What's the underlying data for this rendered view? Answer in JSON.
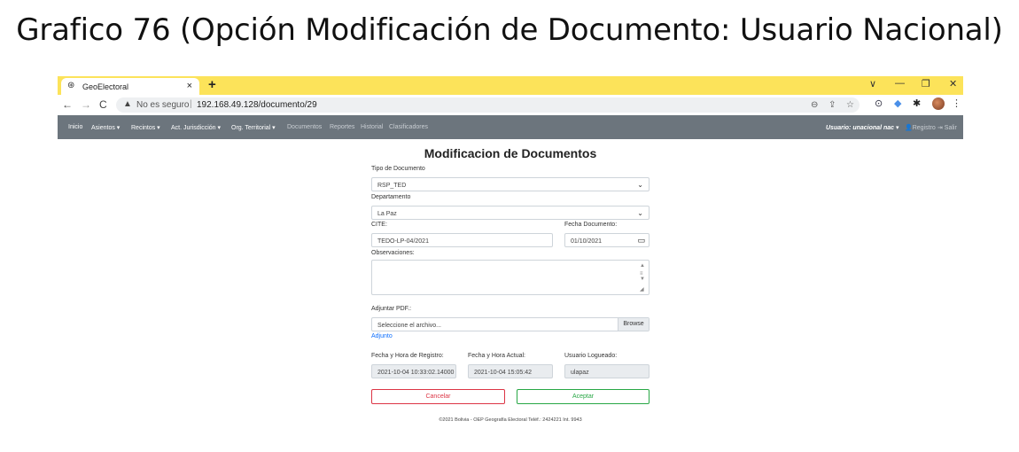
{
  "slide_title": "Grafico 76 (Opción Modificación de Documento: Usuario Nacional)",
  "browser": {
    "tab_title": "GeoElectoral",
    "tab_close": "×",
    "new_tab": "+",
    "insecure_label": "No es seguro",
    "separator": "|",
    "url": "192.168.49.128/documento/29"
  },
  "navbar": {
    "items": [
      {
        "label": "Inicio"
      },
      {
        "label": "Asientos ▾"
      },
      {
        "label": "Recintos ▾"
      },
      {
        "label": "Act. Jurisdicción ▾"
      },
      {
        "label": "Org. Territorial ▾"
      },
      {
        "label": "Documentos"
      },
      {
        "label": "Reportes"
      },
      {
        "label": "Historial"
      },
      {
        "label": "Clasificadores"
      }
    ],
    "user": "Usuario: unacional nac ▾",
    "registro": "👤Registro",
    "salir": "⇥ Salir"
  },
  "form": {
    "heading": "Modificacion de Documentos",
    "tipo_documento": {
      "label": "Tipo de Documento",
      "value": "RSP_TED"
    },
    "departamento": {
      "label": "Departamento",
      "value": "La Paz"
    },
    "cite": {
      "label": "CITE:",
      "value": "TEDO-LP-04/2021"
    },
    "fecha_documento": {
      "label": "Fecha Documento:",
      "value": "01/10/2021"
    },
    "observaciones": {
      "label": "Observaciones:",
      "value": ""
    },
    "adjuntar": {
      "label": "Adjuntar PDF.:",
      "placeholder": "Seleccione el archivo...",
      "browse": "Browse"
    },
    "adjunto_link": "Adjunto",
    "fecha_registro": {
      "label": "Fecha y Hora de Registro:",
      "value": "2021-10-04 10:33:02.14000"
    },
    "fecha_actual": {
      "label": "Fecha y Hora Actual:",
      "value": "2021-10-04 15:05:42"
    },
    "usuario": {
      "label": "Usuario Logueado:",
      "value": "ulapaz"
    },
    "cancel_label": "Cancelar",
    "accept_label": "Aceptar"
  },
  "footer": "©2021 Bolivia - OEP Geografía Electoral Teléf.: 2424221 Int. 9943"
}
